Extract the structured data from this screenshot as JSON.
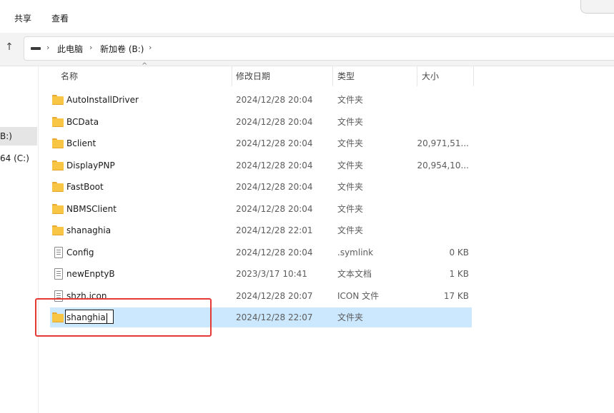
{
  "ribbon": {
    "tabs": [
      "共享",
      "查看"
    ]
  },
  "address": {
    "crumbs": [
      "此电脑",
      "新加卷 (B:)"
    ],
    "separator": "›"
  },
  "nav": {
    "up_glyph": "↑"
  },
  "sidebar": {
    "items": [
      {
        "label": "B:)",
        "active": true
      },
      {
        "label": "64 (C:)",
        "active": false
      }
    ]
  },
  "columns": {
    "name": "名称",
    "date": "修改日期",
    "type": "类型",
    "size": "大小",
    "sort_glyph": "^"
  },
  "files": [
    {
      "name": "AutoInstallDriver",
      "date": "2024/12/28 20:04",
      "type": "文件夹",
      "size": "",
      "icon": "folder-icon"
    },
    {
      "name": "BCData",
      "date": "2024/12/28 20:04",
      "type": "文件夹",
      "size": "",
      "icon": "folder-icon"
    },
    {
      "name": "Bclient",
      "date": "2024/12/28 20:04",
      "type": "文件夹",
      "size": "20,971,51...",
      "icon": "folder-icon"
    },
    {
      "name": "DisplayPNP",
      "date": "2024/12/28 20:04",
      "type": "文件夹",
      "size": "20,954,10...",
      "icon": "folder-icon"
    },
    {
      "name": "FastBoot",
      "date": "2024/12/28 20:04",
      "type": "文件夹",
      "size": "",
      "icon": "folder-icon"
    },
    {
      "name": "NBMSClient",
      "date": "2024/12/28 20:04",
      "type": "文件夹",
      "size": "",
      "icon": "folder-icon"
    },
    {
      "name": "shanaghia",
      "date": "2024/12/28 22:01",
      "type": "文件夹",
      "size": "",
      "icon": "folder-icon"
    },
    {
      "name": "Config",
      "date": "2024/12/28 20:04",
      "type": ".symlink",
      "size": "0 KB",
      "icon": "symlink-file-icon"
    },
    {
      "name": "newEnptyB",
      "date": "2023/3/17 10:41",
      "type": "文本文档",
      "size": "1 KB",
      "icon": "text-file-icon"
    },
    {
      "name": "shzh.icon",
      "date": "2024/12/28 20:07",
      "type": "ICON 文件",
      "size": "17 KB",
      "icon": "icon-file-icon"
    }
  ],
  "renaming": {
    "value": "shanghia",
    "date": "2024/12/28 22:07",
    "type": "文件夹",
    "size": ""
  },
  "colors": {
    "selection": "#cce8ff",
    "highlight_border": "#e53935",
    "folder": "#f8c544"
  }
}
